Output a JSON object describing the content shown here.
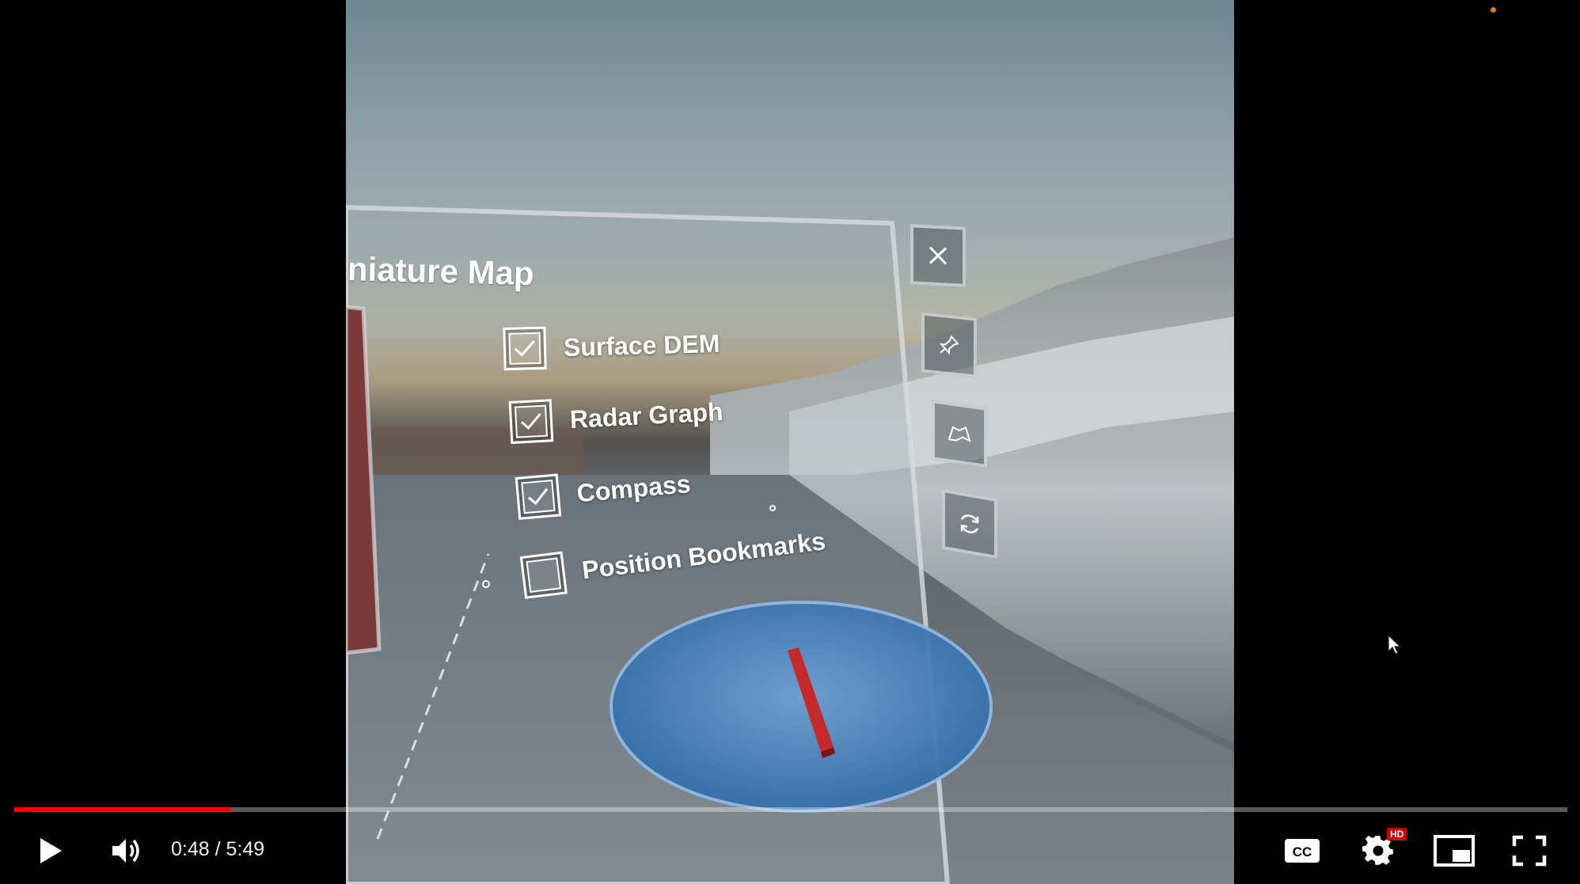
{
  "player": {
    "current_time": "0:48",
    "duration": "5:49",
    "time_display": "0:48 / 5:49",
    "progress_fraction": 0.139,
    "hd_badge": "HD",
    "accent_color": "#ff0000"
  },
  "controls": {
    "play_icon": "play-icon",
    "volume_icon": "volume-icon",
    "cc_icon": "closed-captions-icon",
    "settings_icon": "gear-icon",
    "miniplayer_icon": "miniplayer-icon",
    "fullscreen_icon": "fullscreen-icon"
  },
  "vr_panel": {
    "title": "niature Map",
    "options": [
      {
        "label": "Surface DEM",
        "checked": true
      },
      {
        "label": "Radar Graph",
        "checked": true
      },
      {
        "label": "Compass",
        "checked": true
      },
      {
        "label": "Position Bookmarks",
        "checked": false
      }
    ],
    "side_buttons": [
      "close-icon",
      "pin-icon",
      "map-icon",
      "refresh-icon"
    ]
  }
}
